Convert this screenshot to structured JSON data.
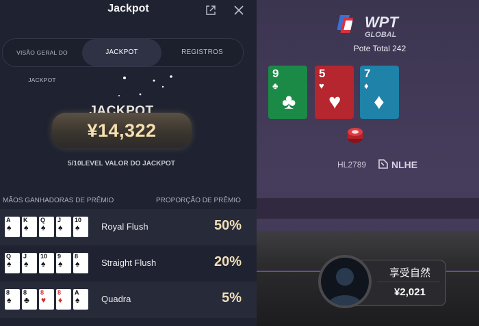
{
  "panel": {
    "title": "Jackpot",
    "tabs": [
      {
        "label": "VISÃO GERAL DO JACKPOT",
        "active": false
      },
      {
        "label": "JACKPOT",
        "active": true
      },
      {
        "label": "REGISTROS",
        "active": false
      }
    ],
    "jackpot_label": "JACKPOT",
    "jackpot_amount": "¥14,322",
    "jackpot_subtitle": "5/10LEVEL VALOR DO JACKPOT",
    "columns": {
      "hands": "MÃOS GANHADORAS DE PRÊMIO",
      "ratio": "PROPORÇÃO DE PRÊMIO"
    },
    "hands": [
      {
        "name": "Royal Flush",
        "percent": "50%",
        "cards": [
          {
            "rank": "A",
            "suit": "♠"
          },
          {
            "rank": "K",
            "suit": "♠"
          },
          {
            "rank": "Q",
            "suit": "♠"
          },
          {
            "rank": "J",
            "suit": "♠"
          },
          {
            "rank": "10",
            "suit": "♠"
          }
        ]
      },
      {
        "name": "Straight Flush",
        "percent": "20%",
        "cards": [
          {
            "rank": "Q",
            "suit": "♠"
          },
          {
            "rank": "J",
            "suit": "♠"
          },
          {
            "rank": "10",
            "suit": "♠"
          },
          {
            "rank": "9",
            "suit": "♠"
          },
          {
            "rank": "8",
            "suit": "♠"
          }
        ]
      },
      {
        "name": "Quadra",
        "percent": "5%",
        "cards": [
          {
            "rank": "8",
            "suit": "♠"
          },
          {
            "rank": "8",
            "suit": "♣"
          },
          {
            "rank": "8",
            "suit": "♥"
          },
          {
            "rank": "8",
            "suit": "♦"
          },
          {
            "rank": "A",
            "suit": "♠"
          }
        ]
      }
    ]
  },
  "table": {
    "logo_text": "WPT",
    "logo_sub": "GLOBAL",
    "pot": "Pote Total 242",
    "board": [
      {
        "rank": "9",
        "suit": "♣",
        "color": "#1c8a47"
      },
      {
        "rank": "5",
        "suit": "♥",
        "color": "#b6262e"
      },
      {
        "rank": "7",
        "suit": "♦",
        "color": "#1f82a8"
      }
    ],
    "game_id": "HL2789",
    "game_type": "NLHE",
    "player": {
      "name": "享受自然",
      "stack": "¥2,021"
    }
  },
  "icons": [
    "share-icon",
    "close-icon",
    "wpt-logo",
    "chip-icon",
    "nlhe-icon",
    "avatar-icon"
  ],
  "colors": {
    "accent_gold": "#f0dfb8",
    "panel_bg": "#1f2230",
    "table_felt": "#463d5c"
  }
}
